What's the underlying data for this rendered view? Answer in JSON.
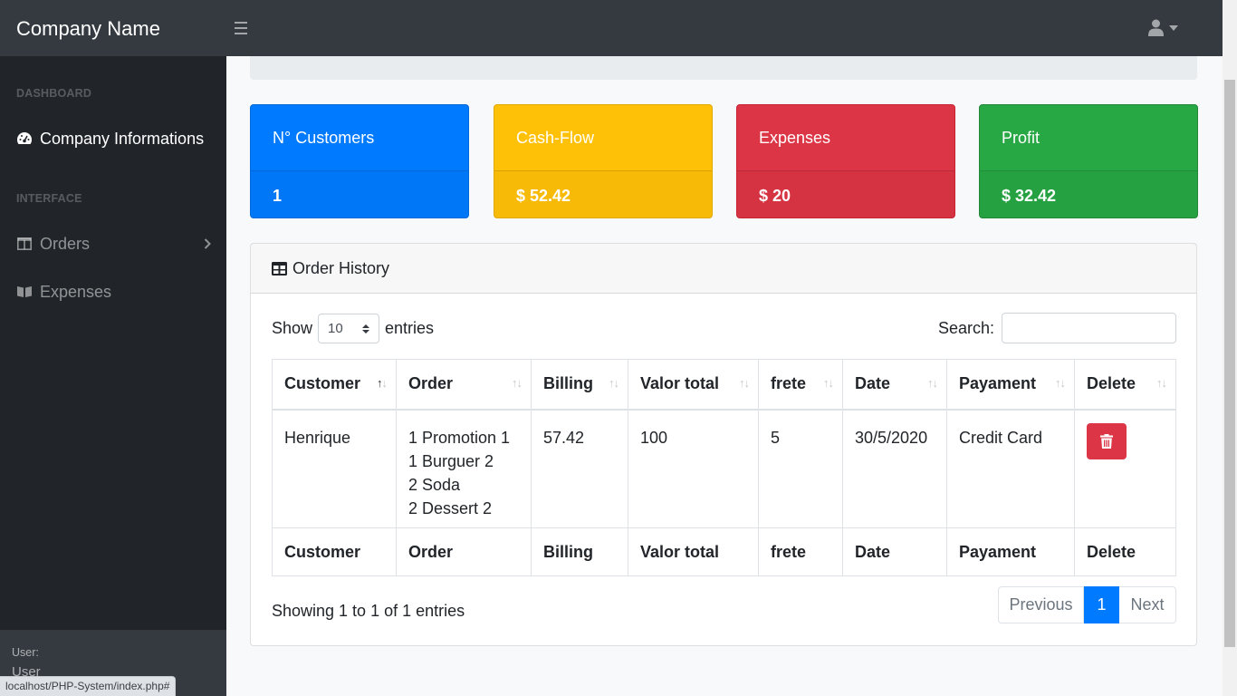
{
  "navbar": {
    "brand": "Company Name",
    "toggle_icon": "bars-icon",
    "user_icon": "user-icon"
  },
  "sidebar": {
    "heading_dashboard": "DASHBOARD",
    "company_info": "Company Informations",
    "heading_interface": "INTERFACE",
    "orders": "Orders",
    "expenses": "Expenses",
    "footer_label": "User:",
    "footer_user": "User"
  },
  "stats": [
    {
      "label": "N° Customers",
      "value": "1",
      "color": "#007bff"
    },
    {
      "label": "Cash-Flow",
      "value": "$ 52.42",
      "color": "#ffc107"
    },
    {
      "label": "Expenses",
      "value": "$ 20",
      "color": "#dc3545"
    },
    {
      "label": "Profit",
      "value": "$ 32.42",
      "color": "#28a745"
    }
  ],
  "order_history": {
    "title": "Order History",
    "show_label": "Show",
    "entries_label": "entries",
    "page_length": "10",
    "search_label": "Search:",
    "search_value": "",
    "columns": [
      "Customer",
      "Order",
      "Billing",
      "Valor total",
      "frete",
      "Date",
      "Payament",
      "Delete"
    ],
    "rows": [
      {
        "customer": "Henrique",
        "order_lines": [
          "1 Promotion 1",
          "1 Burguer 2",
          "2 Soda",
          "2 Dessert 2"
        ],
        "billing": "57.42",
        "valor_total": "100",
        "frete": "5",
        "date": "30/5/2020",
        "payament": "Credit Card"
      }
    ],
    "info": "Showing 1 to 1 of 1 entries",
    "pagination": {
      "previous": "Previous",
      "current": "1",
      "next": "Next"
    }
  },
  "status_bar": "localhost/PHP-System/index.php#"
}
